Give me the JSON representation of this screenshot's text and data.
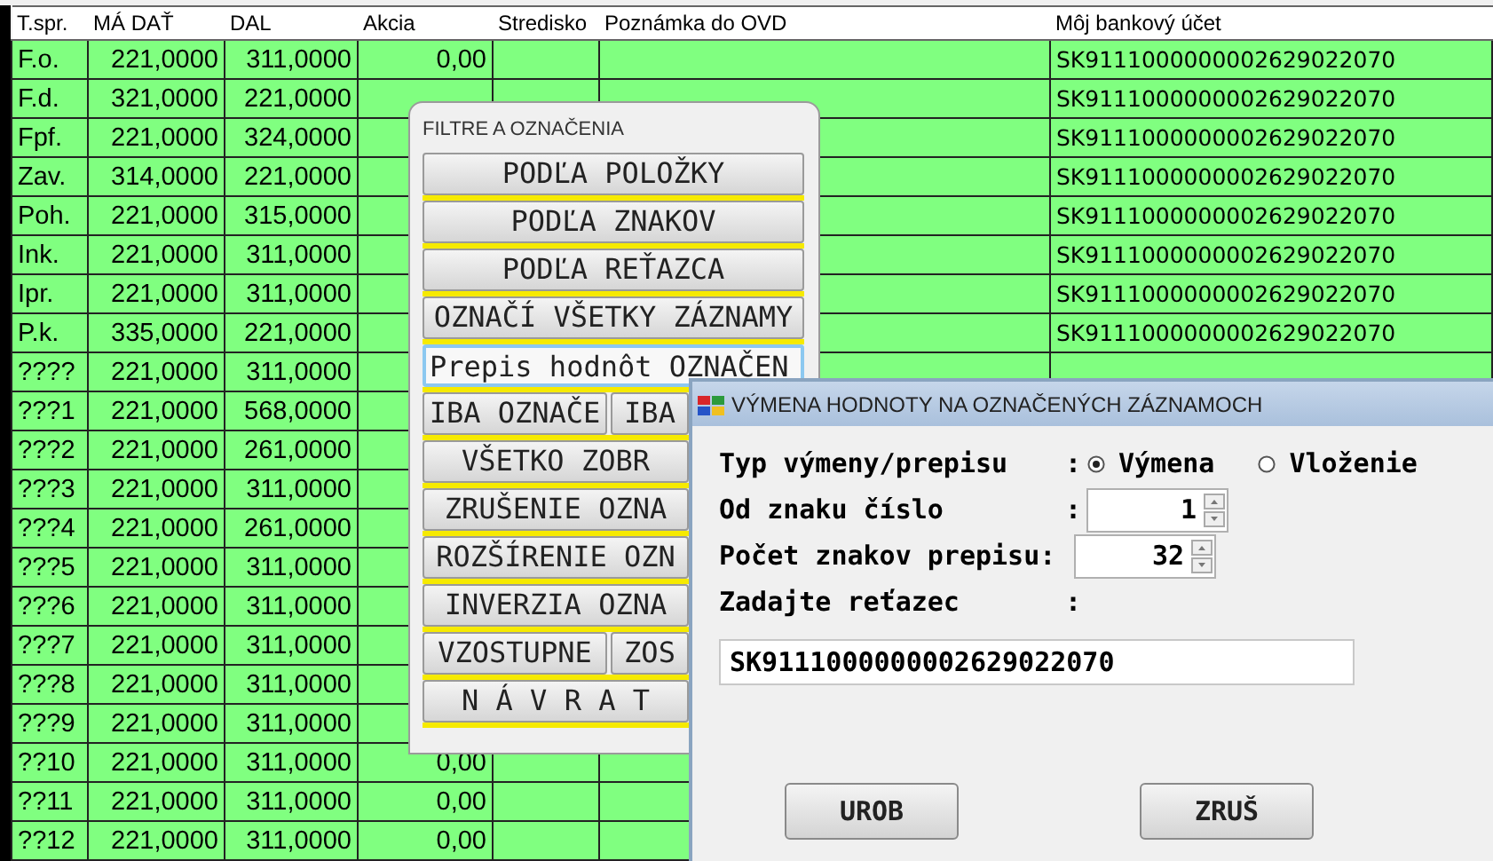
{
  "table": {
    "columns": [
      "T.spr.",
      "MÁ DAŤ",
      "DAL",
      "Akcia",
      "Stredisko",
      "Poznámka do OVD",
      "Môj bankový účet"
    ],
    "rows": [
      {
        "t_spr": "F.o.",
        "ma_dat": "221,0000",
        "dal": "311,0000",
        "akcia": "0,00",
        "account": "SK9111000000002629022070"
      },
      {
        "t_spr": "F.d.",
        "ma_dat": "321,0000",
        "dal": "221,0000",
        "account": "SK9111000000002629022070"
      },
      {
        "t_spr": "Fpf.",
        "ma_dat": "221,0000",
        "dal": "324,0000",
        "account": "SK9111000000002629022070"
      },
      {
        "t_spr": "Zav.",
        "ma_dat": "314,0000",
        "dal": "221,0000",
        "account": "SK9111000000002629022070"
      },
      {
        "t_spr": "Poh.",
        "ma_dat": "221,0000",
        "dal": "315,0000",
        "account": "SK9111000000002629022070"
      },
      {
        "t_spr": "Ink.",
        "ma_dat": "221,0000",
        "dal": "311,0000",
        "account": "SK9111000000002629022070"
      },
      {
        "t_spr": "Ipr.",
        "ma_dat": "221,0000",
        "dal": "311,0000",
        "account": "SK9111000000002629022070"
      },
      {
        "t_spr": "P.k.",
        "ma_dat": "335,0000",
        "dal": "221,0000",
        "account": "SK9111000000002629022070"
      },
      {
        "t_spr": "????",
        "ma_dat": "221,0000",
        "dal": "311,0000"
      },
      {
        "t_spr": "???1",
        "ma_dat": "221,0000",
        "dal": "568,0000"
      },
      {
        "t_spr": "???2",
        "ma_dat": "221,0000",
        "dal": "261,0000"
      },
      {
        "t_spr": "???3",
        "ma_dat": "221,0000",
        "dal": "311,0000"
      },
      {
        "t_spr": "???4",
        "ma_dat": "221,0000",
        "dal": "261,0000"
      },
      {
        "t_spr": "???5",
        "ma_dat": "221,0000",
        "dal": "311,0000"
      },
      {
        "t_spr": "???6",
        "ma_dat": "221,0000",
        "dal": "311,0000"
      },
      {
        "t_spr": "???7",
        "ma_dat": "221,0000",
        "dal": "311,0000"
      },
      {
        "t_spr": "???8",
        "ma_dat": "221,0000",
        "dal": "311,0000"
      },
      {
        "t_spr": "???9",
        "ma_dat": "221,0000",
        "dal": "311,0000"
      },
      {
        "t_spr": "??10",
        "ma_dat": "221,0000",
        "dal": "311,0000",
        "akcia": "0,00"
      },
      {
        "t_spr": "??11",
        "ma_dat": "221,0000",
        "dal": "311,0000",
        "akcia": "0,00"
      },
      {
        "t_spr": "??12",
        "ma_dat": "221,0000",
        "dal": "311,0000",
        "akcia": "0,00"
      }
    ]
  },
  "filter_panel": {
    "title": "FILTRE A OZNAČENIA",
    "button_rows": [
      [
        {
          "label": "PODĽA POLOŽKY",
          "focused": false
        }
      ],
      [
        {
          "label": "PODĽA ZNAKOV",
          "focused": false
        }
      ],
      [
        {
          "label": "PODĽA REŤAZCA",
          "focused": false
        }
      ],
      [
        {
          "label": "OZNAČÍ VŠETKY ZÁZNAMY",
          "focused": false
        }
      ],
      [
        {
          "label": "Prepis hodnôt OZNAČEN",
          "focused": true
        }
      ],
      [
        {
          "label": "IBA OZNAČE",
          "focused": false
        },
        {
          "label": "IBA",
          "focused": false
        }
      ],
      [
        {
          "label": "VŠETKO ZOBR",
          "focused": false
        }
      ],
      [
        {
          "label": "ZRUŠENIE OZNA",
          "focused": false
        }
      ],
      [
        {
          "label": "ROZŠÍRENIE OZN",
          "focused": false
        }
      ],
      [
        {
          "label": "INVERZIA OZNA",
          "focused": false
        }
      ],
      [
        {
          "label": "VZOSTUPNE",
          "focused": false
        },
        {
          "label": "ZOS",
          "focused": false
        }
      ],
      [
        {
          "label": "N Á V R A T",
          "focused": false
        }
      ]
    ]
  },
  "dialog": {
    "title": "VÝMENA HODNOTY NA OZNAČENÝCH ZÁZNAMOCH",
    "fields": [
      {
        "kind": "radio",
        "label": "Typ výmeny/prepisu",
        "colon": ":",
        "options": [
          {
            "label": "Výmena",
            "selected": true
          },
          {
            "label": "Vloženie",
            "selected": false
          }
        ]
      },
      {
        "kind": "spin",
        "label": "Od znaku číslo",
        "colon": ":",
        "value": "1"
      },
      {
        "kind": "spin",
        "label": "Počet znakov prepisu:",
        "value": "32"
      },
      {
        "kind": "label",
        "label": "Zadajte reťazec",
        "colon": ":"
      },
      {
        "kind": "input",
        "value": "SK9111000000002629022070"
      }
    ],
    "buttons": [
      "UROB",
      "ZRUŠ"
    ]
  }
}
